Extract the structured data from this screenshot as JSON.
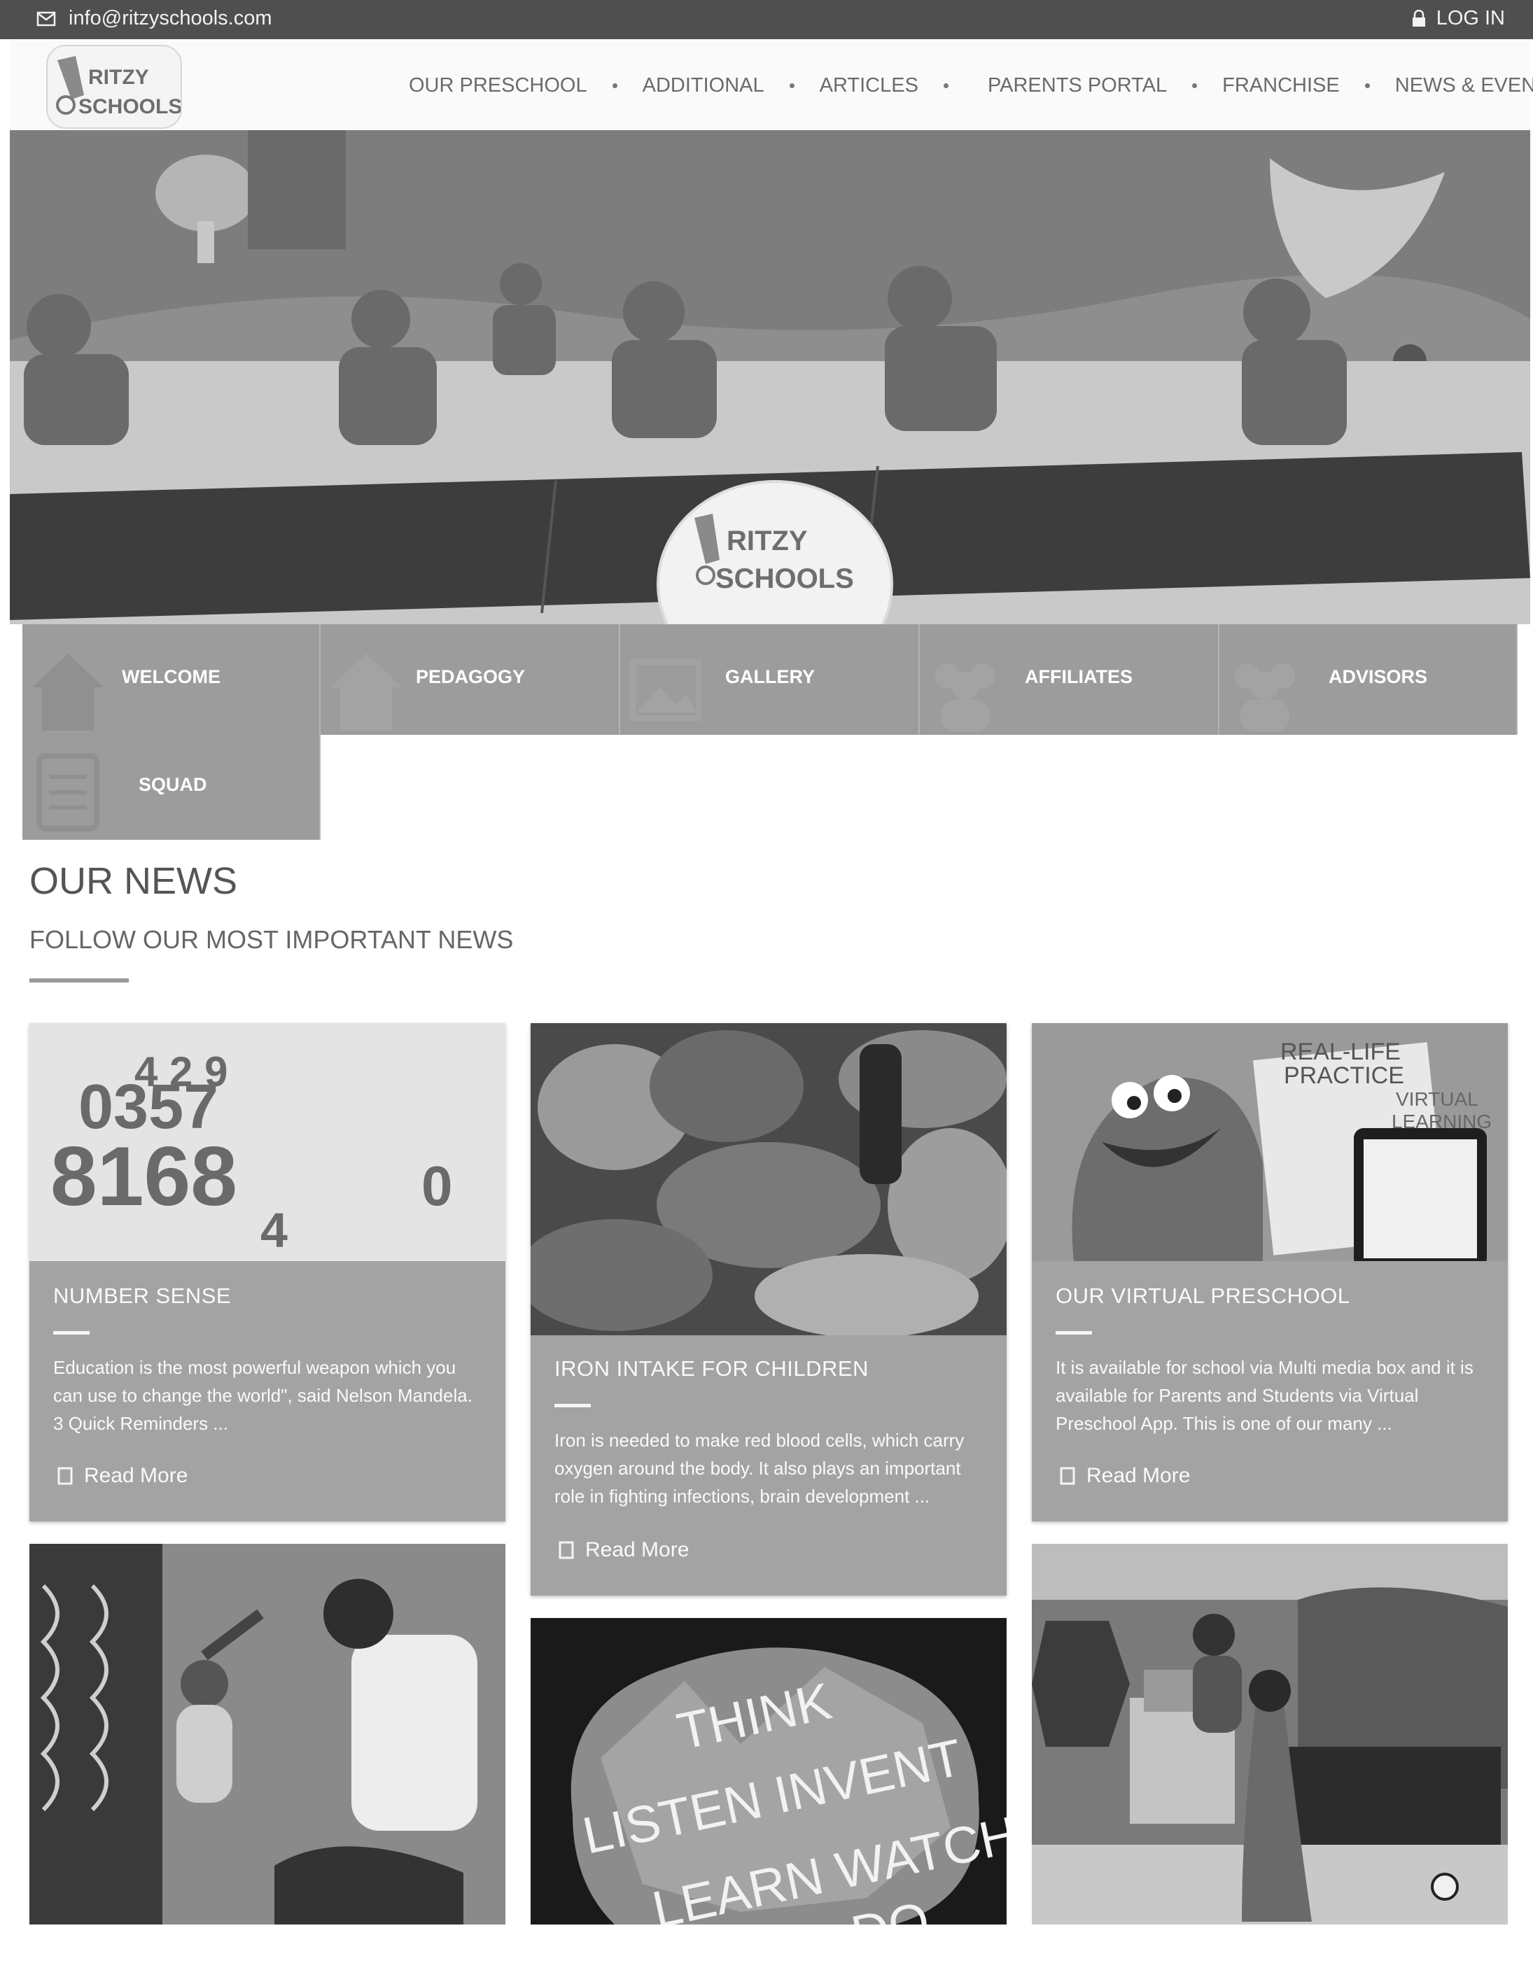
{
  "topbar": {
    "email": "info@ritzyschools.com",
    "login": "LOG IN"
  },
  "brand": {
    "logo_line1": "RITZY",
    "logo_line2": "SCHOOLS"
  },
  "nav": {
    "items": [
      "OUR PRESCHOOL",
      "ADDITIONAL",
      "ARTICLES",
      "PARENTS PORTAL",
      "FRANCHISE",
      "NEWS & EVENTS"
    ]
  },
  "tiles": [
    "WELCOME",
    "PEDAGOGY",
    "GALLERY",
    "AFFILIATES",
    "ADVISORS",
    "SQUAD"
  ],
  "news": {
    "title": "OUR NEWS",
    "subtitle": "FOLLOW OUR MOST IMPORTANT NEWS",
    "cards": [
      {
        "title": "NUMBER SENSE",
        "text": "Education is the most powerful weapon which you can use to change the world\", said Nelson Mandela. 3 Quick Reminders    ...",
        "read_more": "Read More"
      },
      {
        "title": "IRON INTAKE FOR CHILDREN",
        "text": "Iron is needed to make red blood cells, which carry oxygen around the body. It also plays an important role in fighting infections, brain development ...",
        "read_more": "Read More"
      },
      {
        "title": "OUR VIRTUAL PRESCHOOL",
        "text": "It is available for school via Multi media box and it is available for Parents and Students via Virtual Preschool App.   This is one of our many ...",
        "read_more": "Read More"
      }
    ],
    "image_texts": {
      "virtual_1": "REAL-LIFE",
      "virtual_2": "PRACTICE",
      "virtual_3": "VIRTUAL",
      "virtual_4": "LEARNING",
      "brain_1": "THINK",
      "brain_2": "LISTEN INVENT",
      "brain_3": "LEARN WATCH",
      "brain_4": "DO"
    }
  },
  "colors": {
    "topbar": "#4f4f4f",
    "tile": "#9c9c9c",
    "card": "#a3a3a3"
  }
}
